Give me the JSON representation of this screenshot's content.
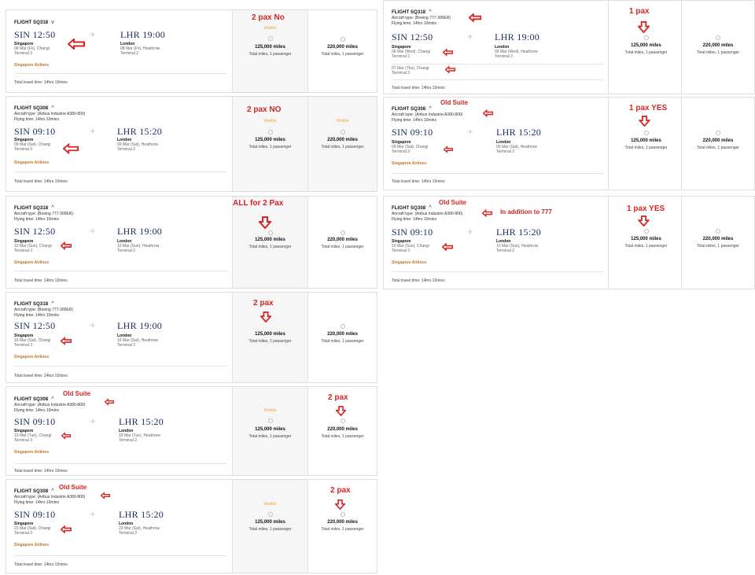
{
  "common": {
    "origin_code": "SIN",
    "dest_code": "LHR",
    "origin_city": "Singapore",
    "dest_city": "London",
    "origin_terminal": "Terminal 3",
    "dest_terminal": "Terminal 2",
    "airline": "Singapore Airlines",
    "total_time": "Total travel time: 14hrs 10mins",
    "flying_time": "Flying time: 14hrs 10mins",
    "chevron_up": "^",
    "chevron_down": "v",
    "waitlist": "Waitlist",
    "saver_miles": "125,000 miles",
    "advantage_miles": "220,000 miles",
    "per_passenger": "Total miles, 1 passenger"
  },
  "left_cards": [
    {
      "flight": "FLIGHT SQ318",
      "aircraft": "",
      "dep_time": "12:50",
      "arr_time": "19:00",
      "dep_detail": "08 Mar (Fri), Changi",
      "arr_detail": "08 Mar (Fri), Heathrow",
      "annotation": "2 pax No"
    },
    {
      "flight": "FLIGHT SQ308",
      "aircraft": "Aircraft type: (Airbus Industrie A380-800)",
      "dep_time": "09:10",
      "arr_time": "15:20",
      "dep_detail": "09 Mar (Sat), Changi",
      "arr_detail": "09 Mar (Sat), Heathrow",
      "annotation": "2 pax NO"
    },
    {
      "flight": "FLIGHT SQ318",
      "aircraft": "Aircraft type: (Boeing 777-300ER)",
      "dep_time": "12:50",
      "arr_time": "19:00",
      "dep_detail": "10 Mar (Sun), Changi",
      "arr_detail": "10 Mar (Sun), Heathrow",
      "annotation": "ALL for 2 Pax"
    },
    {
      "flight": "FLIGHT SQ318",
      "aircraft": "Aircraft type: (Boeing 777-300ER)",
      "dep_time": "12:50",
      "arr_time": "19:00",
      "dep_detail": "16 Mar (Sat), Changi",
      "arr_detail": "16 Mar (Sat), Heathrow",
      "annotation": "2 pax"
    },
    {
      "flight": "FLIGHT SQ308",
      "aircraft": "Aircraft type: (Airbus Industrie A380-800)",
      "dep_time": "09:10",
      "arr_time": "15:20",
      "dep_detail": "19 Mar (Tue), Changi",
      "arr_detail": "19 Mar (Tue), Heathrow",
      "annotation": "2 pax",
      "label_note": "Old Suite"
    },
    {
      "flight": "FLIGHT SQ308",
      "aircraft": "Aircraft type: (Airbus Industrie A380-800)",
      "dep_time": "09:10",
      "arr_time": "15:20",
      "dep_detail": "23 Mar (Sat), Changi",
      "arr_detail": "23 Mar (Sat), Heathrow",
      "annotation": "2 pax",
      "label_note": "Old Suite"
    }
  ],
  "right_cards": [
    {
      "flight": "FLIGHT SQ318",
      "aircraft": "Aircraft type: (Boeing 777-300ER)",
      "dep_time": "12:50",
      "arr_time": "19:00",
      "dep_detail": "06 Mar (Wed), Changi",
      "arr_detail": "06 Mar (Wed), Heathrow",
      "extra_detail": "07 Mar (Thu), Changi",
      "annotation": "1 pax"
    },
    {
      "flight": "FLIGHT SQ308",
      "aircraft": "Aircraft type: (Airbus Industrie A380-800)",
      "dep_time": "09:10",
      "arr_time": "15:20",
      "dep_detail": "09 Mar (Sat), Changi",
      "arr_detail": "09 Mar (Sat), Heathrow",
      "annotation": "1 pax YES",
      "label_note": "Old Suite"
    },
    {
      "flight": "FLIGHT SQ308",
      "aircraft": "Aircraft type: (Airbus Industrie A380-800)",
      "dep_time": "09:10",
      "arr_time": "15:20",
      "dep_detail": "10 Mar (Sun), Changi",
      "arr_detail": "10 Mar (Sun), Heathrow",
      "annotation": "1 pax YES",
      "label_note": "Old Suite",
      "aircraft_note": "In addition to 777"
    }
  ],
  "colors": {
    "annotation_red": "#d62525",
    "time_navy": "#1b2e63",
    "airline_orange": "#c1762b",
    "waitlist_orange": "#f0a640"
  }
}
